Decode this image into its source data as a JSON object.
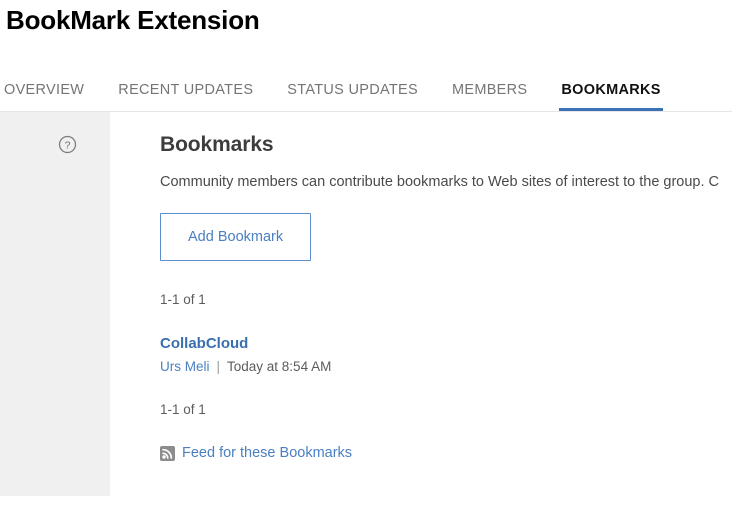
{
  "header": {
    "title": "BookMark Extension"
  },
  "tabs": [
    {
      "label": "OVERVIEW",
      "active": false
    },
    {
      "label": "RECENT UPDATES",
      "active": false
    },
    {
      "label": "STATUS UPDATES",
      "active": false
    },
    {
      "label": "MEMBERS",
      "active": false
    },
    {
      "label": "BOOKMARKS",
      "active": true
    }
  ],
  "sidebar": {
    "help_icon": "help-circle-icon"
  },
  "main": {
    "section_title": "Bookmarks",
    "section_description": "Community members can contribute bookmarks to Web sites of interest to the group. C",
    "add_button_label": "Add Bookmark",
    "pager_top": "1-1 of 1",
    "pager_bottom": "1-1 of 1",
    "bookmarks": [
      {
        "title": "CollabCloud",
        "author": "Urs Meli",
        "separator": "|",
        "date": "Today at 8:54 AM"
      }
    ],
    "feed": {
      "icon": "rss-feed-icon",
      "label": "Feed for these Bookmarks"
    }
  },
  "colors": {
    "accent_blue": "#3a72b8",
    "link_blue": "#4a7fc1",
    "bookmark_link_blue": "#3a6fb0",
    "sidebar_gray": "#f0f0f0",
    "rss_gray": "#8c8c8c",
    "tab_inactive": "#757575",
    "tab_active": "#111111"
  }
}
